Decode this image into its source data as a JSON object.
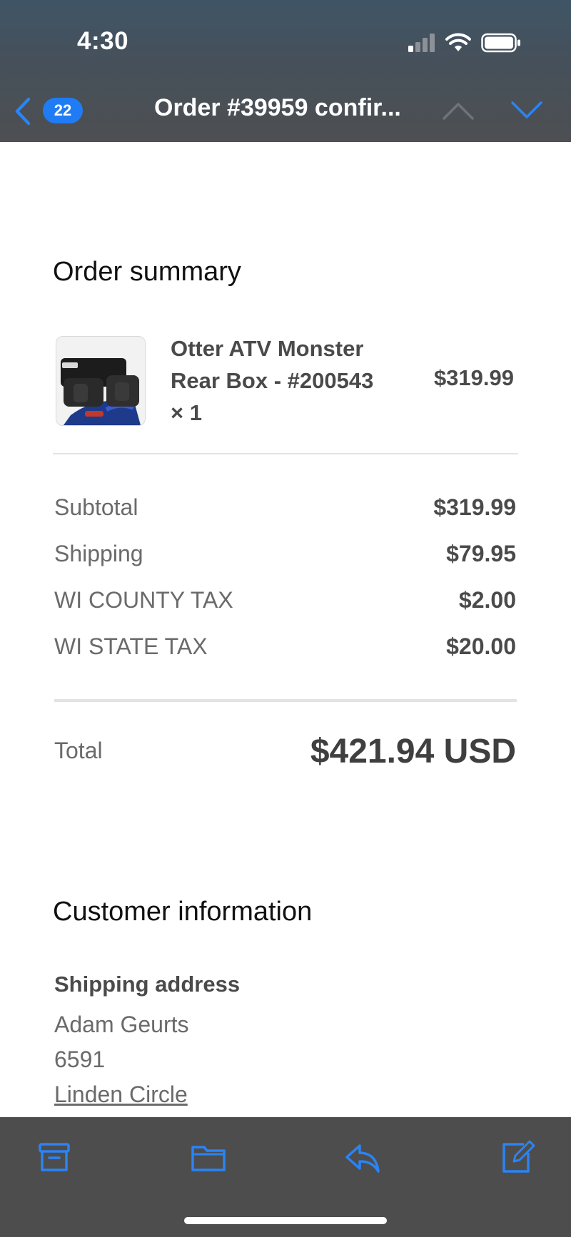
{
  "status_bar": {
    "time": "4:30"
  },
  "nav": {
    "unread_count": "22",
    "title": "Order #39959 confir..."
  },
  "order_summary": {
    "heading": "Order summary",
    "item": {
      "name_line1": "Otter ATV Monster",
      "name_line2": "Rear Box - #200543",
      "quantity": "× 1",
      "price": "$319.99"
    },
    "rows": [
      {
        "label": "Subtotal",
        "value": "$319.99"
      },
      {
        "label": "Shipping",
        "value": "$79.95"
      },
      {
        "label": "WI COUNTY TAX",
        "value": "$2.00"
      },
      {
        "label": "WI STATE TAX",
        "value": "$20.00"
      }
    ],
    "total_label": "Total",
    "total_value": "$421.94 USD"
  },
  "customer_info": {
    "heading": "Customer information",
    "shipping_heading": "Shipping address",
    "address_lines": [
      "Adam Geurts",
      "6591",
      "Linden Circle"
    ]
  },
  "toolbar": {
    "icons": [
      "archive-icon",
      "folder-icon",
      "reply-icon",
      "compose-icon"
    ]
  },
  "colors": {
    "accent": "#1f7cf4",
    "header_bg": "#4d4f52",
    "toolbar_bg": "#4d4d4d"
  }
}
